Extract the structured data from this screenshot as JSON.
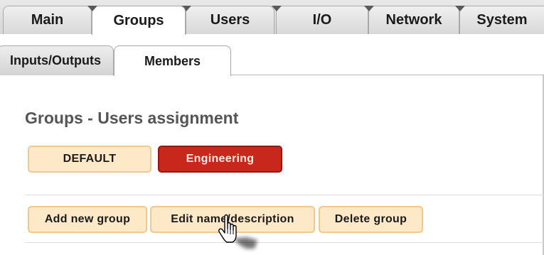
{
  "top_tabs": [
    {
      "label": "Main",
      "active": false
    },
    {
      "label": "Groups",
      "active": true
    },
    {
      "label": "Users",
      "active": false
    },
    {
      "label": "I/O",
      "active": false
    },
    {
      "label": "Network",
      "active": false
    },
    {
      "label": "System",
      "active": false
    }
  ],
  "sub_tabs": [
    {
      "label": "Inputs/Outputs",
      "active": false
    },
    {
      "label": "Members",
      "active": true
    }
  ],
  "section": {
    "title": "Groups - Users assignment"
  },
  "groups": [
    {
      "label": "DEFAULT",
      "selected": false
    },
    {
      "label": "Engineering",
      "selected": true
    }
  ],
  "actions": {
    "add_label": "Add new group",
    "edit_label": "Edit name/description",
    "delete_label": "Delete group"
  },
  "colors": {
    "selected_group": "#c8281c",
    "button_fill": "#fde8c8",
    "button_border": "#f2c88c",
    "title_text": "#555555"
  },
  "cursor": {
    "icon": "hand-pointer-icon"
  }
}
